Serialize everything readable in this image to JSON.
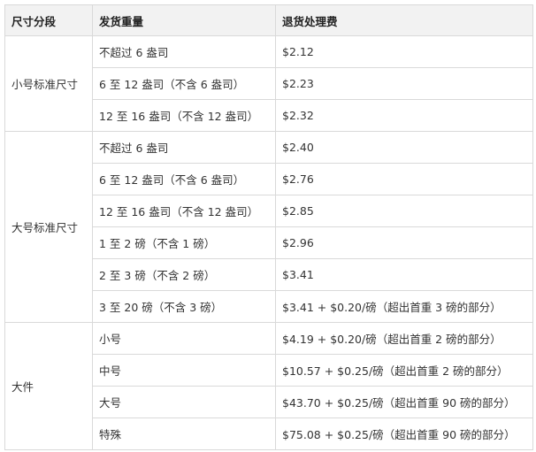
{
  "headers": [
    "尺寸分段",
    "发货重量",
    "退货处理费"
  ],
  "groups": [
    {
      "name": "小号标准尺寸",
      "rows": [
        {
          "weight": "不超过 6 盎司",
          "fee": "$2.12"
        },
        {
          "weight": "6 至 12 盎司（不含 6 盎司）",
          "fee": "$2.23"
        },
        {
          "weight": "12 至 16 盎司（不含 12 盎司）",
          "fee": "$2.32"
        }
      ]
    },
    {
      "name": "大号标准尺寸",
      "rows": [
        {
          "weight": "不超过 6 盎司",
          "fee": "$2.40"
        },
        {
          "weight": "6 至 12 盎司（不含 6 盎司）",
          "fee": "$2.76"
        },
        {
          "weight": "12 至 16 盎司（不含 12 盎司）",
          "fee": "$2.85"
        },
        {
          "weight": "1 至 2 磅（不含 1 磅）",
          "fee": "$2.96"
        },
        {
          "weight": "2 至 3 磅（不含 2 磅）",
          "fee": "$3.41"
        },
        {
          "weight": "3 至 20 磅（不含 3 磅）",
          "fee": "$3.41 + $0.20/磅（超出首重 3 磅的部分）"
        }
      ]
    },
    {
      "name": "大件",
      "rows": [
        {
          "weight": "小号",
          "fee": "$4.19 + $0.20/磅（超出首重 2 磅的部分）"
        },
        {
          "weight": "中号",
          "fee": "$10.57 + $0.25/磅（超出首重 2 磅的部分）"
        },
        {
          "weight": "大号",
          "fee": "$43.70 + $0.25/磅（超出首重 90 磅的部分）"
        },
        {
          "weight": "特殊",
          "fee": "$75.08 + $0.25/磅（超出首重 90 磅的部分）"
        }
      ]
    }
  ]
}
